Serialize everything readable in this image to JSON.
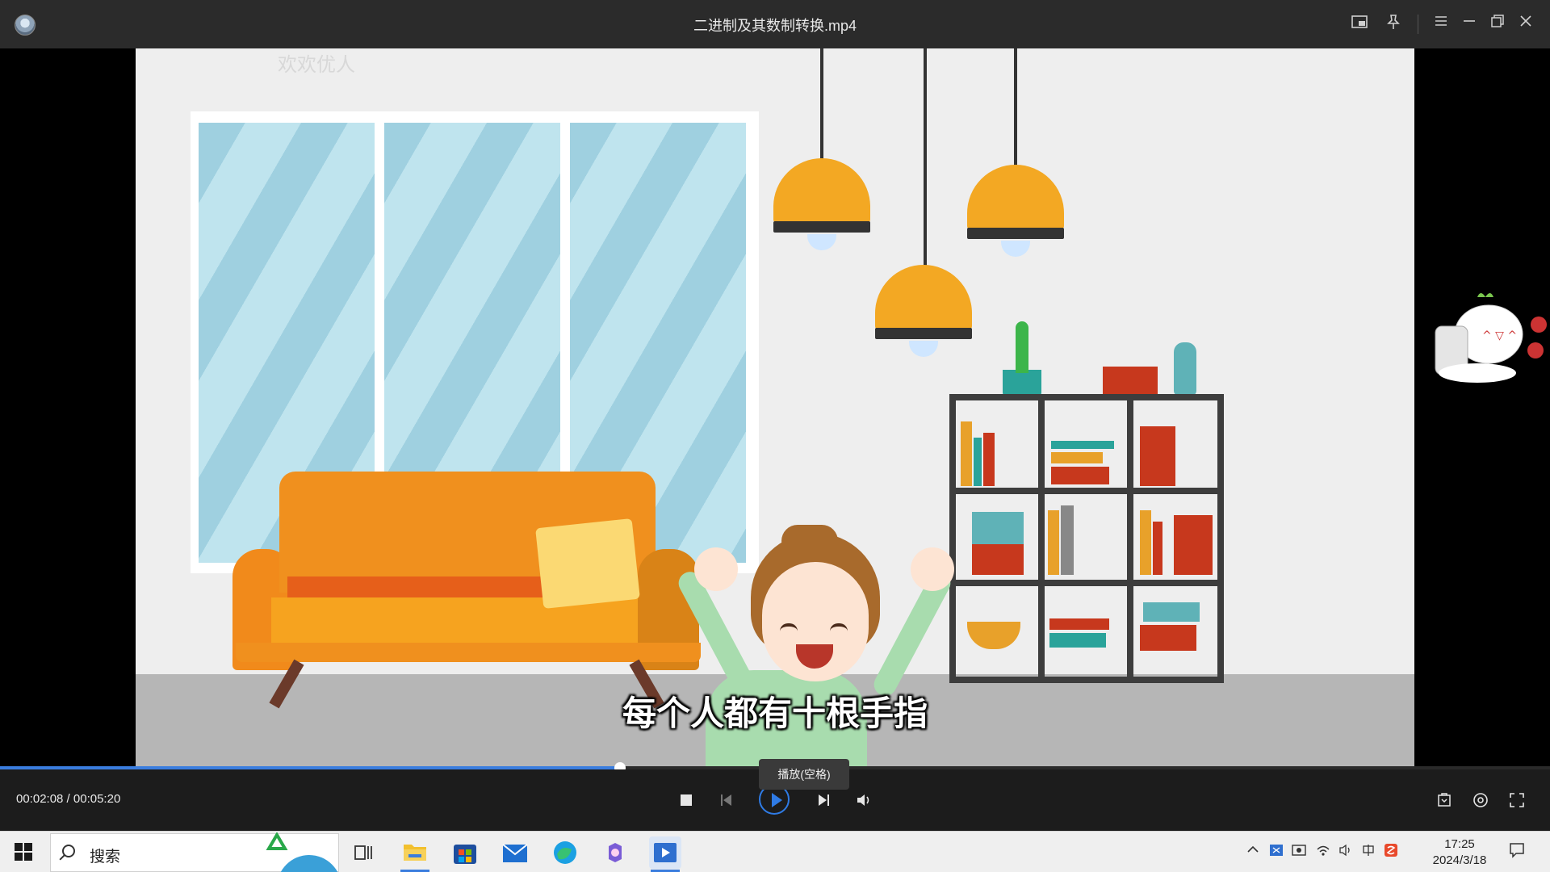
{
  "window": {
    "title": "二进制及其数制转换.mp4",
    "buttons": [
      "picture-in-picture",
      "pin",
      "menu",
      "minimize",
      "restore",
      "close"
    ]
  },
  "video": {
    "watermark": "欢欢优人",
    "subtitle": "每个人都有十根手指"
  },
  "player": {
    "current_time": "00:02:08",
    "duration": "00:05:20",
    "time_display": "00:02:08 / 00:05:20",
    "progress": 0.4,
    "tooltip": "播放(空格)",
    "accent_color": "#2f7be5"
  },
  "taskbar": {
    "search_placeholder": "搜索",
    "time": "17:25",
    "date": "2024/3/18"
  }
}
